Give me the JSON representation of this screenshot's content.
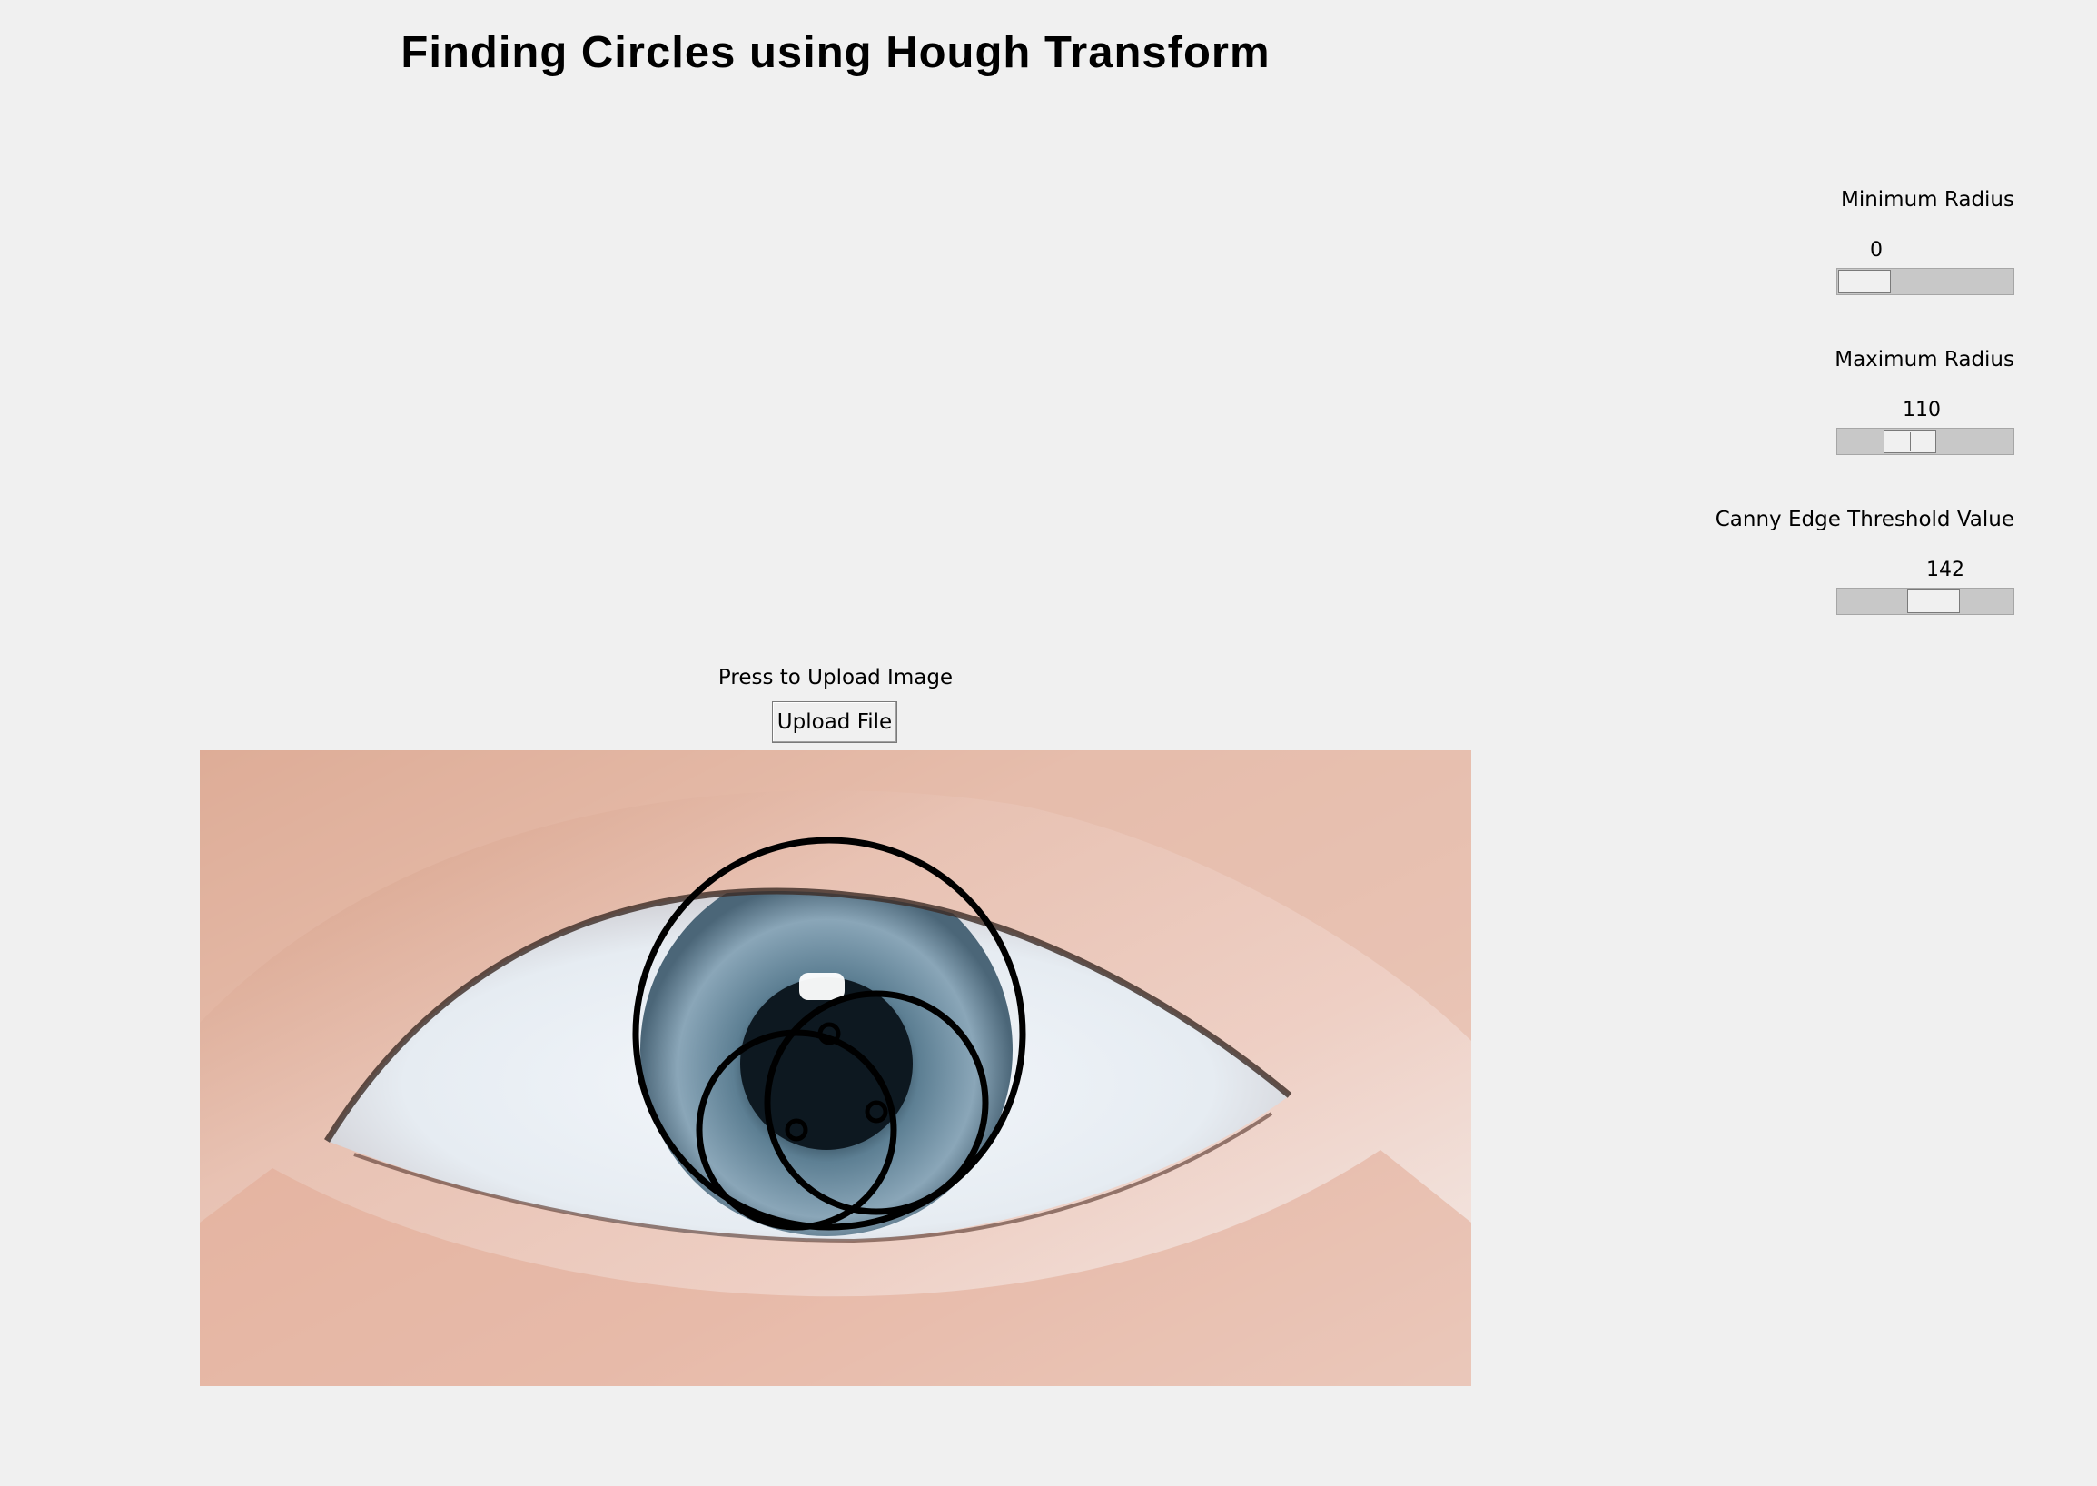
{
  "window": {
    "title": "Finding Circles using Hough Transform"
  },
  "sliders": [
    {
      "label": "Minimum Radius",
      "value": "0",
      "fraction": 0.0
    },
    {
      "label": "Maximum Radius",
      "value": "110",
      "fraction": 0.26
    },
    {
      "label": "Canny Edge Threshold Value",
      "value": "142",
      "fraction": 0.39
    }
  ],
  "upload": {
    "label": "Press to Upload Image",
    "button_label": "Upload File"
  },
  "image": {
    "subject": "close-up eye photo with detected circles drawn in black",
    "overlay_color": "#000000"
  }
}
